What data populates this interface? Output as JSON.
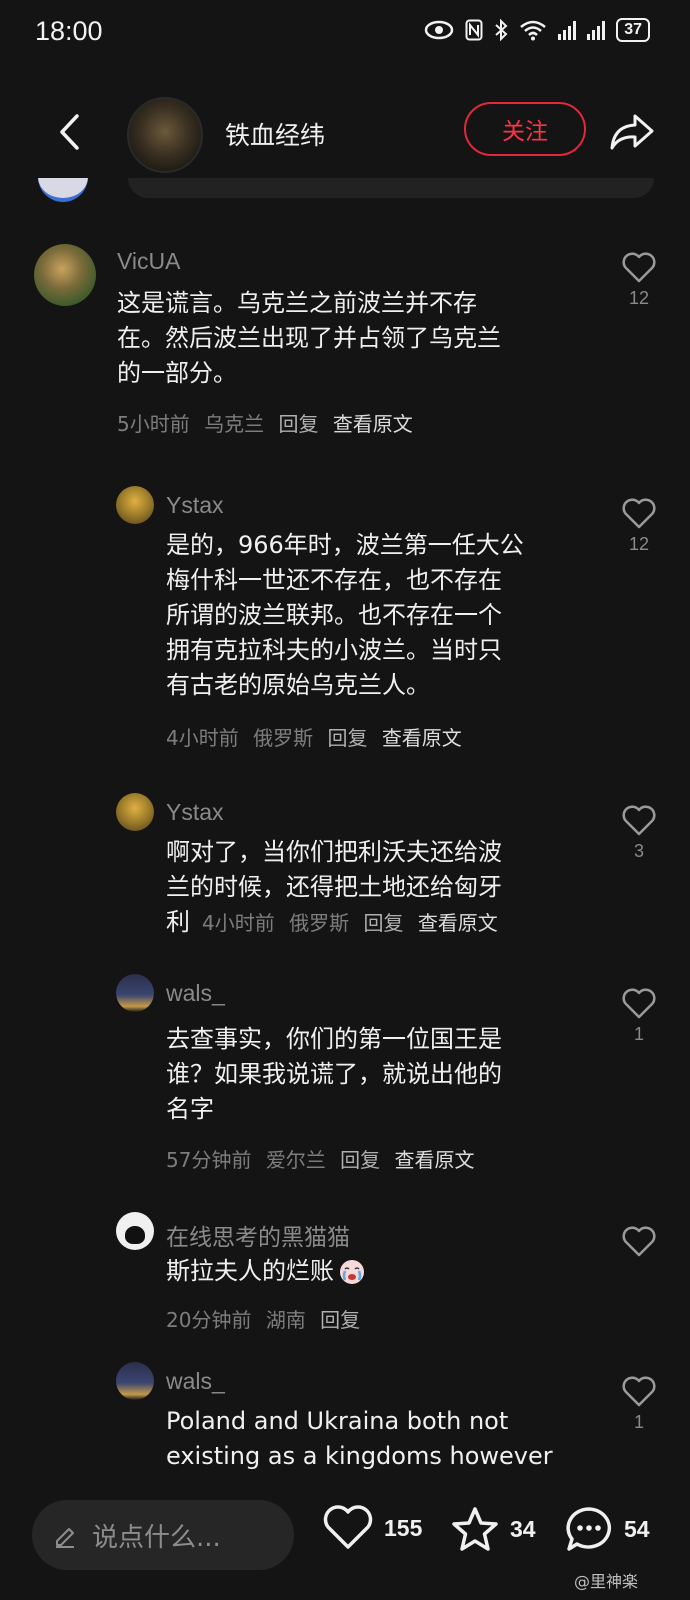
{
  "status_bar": {
    "time": "18:00",
    "battery": "37"
  },
  "header": {
    "channel_name": "铁血经纬",
    "follow_label": "关注"
  },
  "comments": [
    {
      "username": "VicUA",
      "lines": [
        "这是谎言。乌克兰之前波兰并不存",
        "在。然后波兰出现了并占领了乌克兰",
        "的一部分。"
      ],
      "time": "5小时前",
      "location": "乌克兰",
      "reply_label": "回复",
      "orig_label": "查看原文",
      "likes": "12"
    },
    {
      "username": "Ystax",
      "lines": [
        "是的，966年时，波兰第一任大公",
        "梅什科一世还不存在，也不存在",
        "所谓的波兰联邦。也不存在一个",
        "拥有克拉科夫的小波兰。当时只",
        "有古老的原始乌克兰人。"
      ],
      "time": "4小时前",
      "location": "俄罗斯",
      "reply_label": "回复",
      "orig_label": "查看原文",
      "likes": "12"
    },
    {
      "username": "Ystax",
      "lines": [
        "啊对了，当你们把利沃夫还给波",
        "兰的时候，还得把土地还给匈牙"
      ],
      "last_line": "利",
      "time": "4小时前",
      "location": "俄罗斯",
      "reply_label": "回复",
      "orig_label": "查看原文",
      "likes": "3"
    },
    {
      "username": "wals_",
      "lines": [
        "去查事实，你们的第一位国王是",
        "谁？如果我说谎了，就说出他的",
        "名字"
      ],
      "time": "57分钟前",
      "location": "爱尔兰",
      "reply_label": "回复",
      "orig_label": "查看原文",
      "likes": "1"
    },
    {
      "username": "在线思考的黑猫猫",
      "lines": [
        "斯拉夫人的烂账"
      ],
      "time": "20分钟前",
      "location": "湖南",
      "reply_label": "回复"
    },
    {
      "username": "wals_",
      "lines": [
        "Poland and Ukraina both not",
        "existing as a kingdoms however"
      ],
      "likes": "1"
    }
  ],
  "bottom_bar": {
    "placeholder": "说点什么...",
    "likes": "155",
    "favorites": "34",
    "comments": "54"
  },
  "watermark": "@里神楽",
  "colors": {
    "background": "#141414",
    "accent": "#e2283a"
  },
  "icons": [
    "back-arrow-icon",
    "share-icon",
    "heart-icon",
    "star-icon",
    "comment-bubble-icon",
    "pencil-icon",
    "crying-emoji-icon"
  ]
}
